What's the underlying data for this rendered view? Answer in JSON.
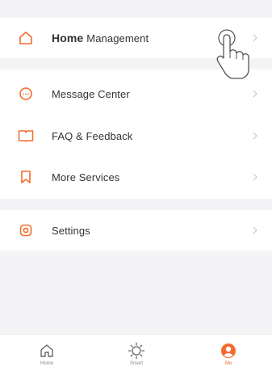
{
  "colors": {
    "accent": "#f26b2c",
    "background": "#f4f4f6",
    "card": "#ffffff"
  },
  "menu": {
    "home_management": {
      "strong": "Home",
      "rest": "Management",
      "icon": "home-icon"
    },
    "items": [
      {
        "label": "Message Center",
        "icon": "message-icon"
      },
      {
        "label": "FAQ & Feedback",
        "icon": "book-icon"
      },
      {
        "label": "More Services",
        "icon": "bookmark-icon"
      }
    ],
    "settings": {
      "label": "Settings",
      "icon": "gear-icon"
    }
  },
  "tabbar": {
    "tabs": [
      {
        "label": "Home",
        "icon": "home-outline-icon",
        "active": false
      },
      {
        "label": "Smart",
        "icon": "sun-icon",
        "active": false
      },
      {
        "label": "Me",
        "icon": "person-icon",
        "active": true
      }
    ]
  }
}
